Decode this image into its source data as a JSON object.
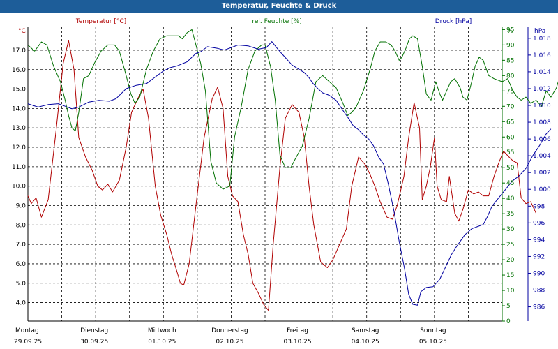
{
  "title": "Temperatur, Feuchte & Druck",
  "colors": {
    "temperature": "#b00000",
    "humidity": "#007000",
    "pressure": "#0000a0",
    "title_bg": "#1d5d99",
    "grid": "#000000"
  },
  "chart_data": {
    "type": "line",
    "title": "Temperatur, Feuchte & Druck",
    "grid": true,
    "x_axis": {
      "range": [
        0,
        7
      ],
      "days": [
        "Montag",
        "Dienstag",
        "Mittwoch",
        "Donnerstag",
        "Freitag",
        "Samstag",
        "Sonntag"
      ],
      "dates": [
        "29.09.25",
        "30.09.25",
        "01.10.25",
        "02.10.25",
        "03.10.25",
        "04.10.25",
        "05.10.25"
      ]
    },
    "axes": {
      "temperature": {
        "label": "Temperatur [°C]",
        "unit": "°C",
        "side": "left",
        "range": [
          3.05,
          18.22
        ],
        "ticks": [
          "4.0",
          "5.0",
          "6.0",
          "7.0",
          "8.0",
          "9.0",
          "10.0",
          "11.0",
          "12.0",
          "13.0",
          "14.0",
          "15.0",
          "16.0",
          "17.0"
        ]
      },
      "humidity": {
        "label": "rel. Feuchte [%]",
        "unit": "%",
        "side": "right",
        "range": [
          0,
          96
        ],
        "ticks": [
          "0",
          "5",
          "10",
          "15",
          "20",
          "25",
          "30",
          "35",
          "40",
          "45",
          "50",
          "55",
          "60",
          "65",
          "70",
          "75",
          "80",
          "85",
          "90",
          "95"
        ]
      },
      "pressure": {
        "label": "Druck [hPa]",
        "unit": "hPa",
        "side": "right",
        "range": [
          984.3,
          1019.4
        ],
        "ticks": [
          "986",
          "988",
          "990",
          "992",
          "994",
          "996",
          "998",
          "1.000",
          "1.002",
          "1.004",
          "1.006",
          "1.008",
          "1.010",
          "1.012",
          "1.014",
          "1.016",
          "1.018"
        ]
      }
    },
    "series": [
      {
        "name": "Temperatur [°C]",
        "axis": "temperature",
        "points": [
          [
            0,
            9.5
          ],
          [
            0.05,
            9.1
          ],
          [
            0.12,
            9.4
          ],
          [
            0.2,
            8.4
          ],
          [
            0.3,
            9.3
          ],
          [
            0.42,
            13.0
          ],
          [
            0.52,
            16.3
          ],
          [
            0.6,
            17.5
          ],
          [
            0.68,
            16.0
          ],
          [
            0.75,
            12.5
          ],
          [
            0.85,
            11.5
          ],
          [
            0.95,
            10.8
          ],
          [
            1.03,
            10.0
          ],
          [
            1.1,
            9.8
          ],
          [
            1.18,
            10.1
          ],
          [
            1.25,
            9.7
          ],
          [
            1.35,
            10.3
          ],
          [
            1.45,
            12.0
          ],
          [
            1.53,
            13.8
          ],
          [
            1.62,
            14.5
          ],
          [
            1.7,
            15.0
          ],
          [
            1.78,
            13.5
          ],
          [
            1.88,
            10.0
          ],
          [
            1.96,
            8.5
          ],
          [
            2.05,
            7.5
          ],
          [
            2.12,
            6.5
          ],
          [
            2.2,
            5.6
          ],
          [
            2.25,
            5.0
          ],
          [
            2.3,
            4.9
          ],
          [
            2.38,
            6.0
          ],
          [
            2.48,
            9.0
          ],
          [
            2.6,
            12.5
          ],
          [
            2.72,
            14.5
          ],
          [
            2.8,
            15.1
          ],
          [
            2.88,
            14.0
          ],
          [
            2.95,
            10.5
          ],
          [
            3.02,
            9.5
          ],
          [
            3.1,
            9.2
          ],
          [
            3.18,
            7.5
          ],
          [
            3.25,
            6.5
          ],
          [
            3.32,
            5.0
          ],
          [
            3.4,
            4.5
          ],
          [
            3.48,
            3.9
          ],
          [
            3.55,
            3.6
          ],
          [
            3.62,
            7.0
          ],
          [
            3.72,
            11.0
          ],
          [
            3.8,
            13.5
          ],
          [
            3.9,
            14.2
          ],
          [
            4.0,
            13.8
          ],
          [
            4.08,
            12.5
          ],
          [
            4.15,
            10.0
          ],
          [
            4.22,
            8.0
          ],
          [
            4.32,
            6.1
          ],
          [
            4.42,
            5.8
          ],
          [
            4.5,
            6.2
          ],
          [
            4.6,
            7.0
          ],
          [
            4.7,
            7.8
          ],
          [
            4.78,
            10.0
          ],
          [
            4.88,
            11.5
          ],
          [
            4.98,
            11.1
          ],
          [
            5.05,
            10.6
          ],
          [
            5.12,
            10.0
          ],
          [
            5.2,
            9.2
          ],
          [
            5.3,
            8.4
          ],
          [
            5.38,
            8.3
          ],
          [
            5.45,
            9.0
          ],
          [
            5.55,
            10.5
          ],
          [
            5.62,
            12.5
          ],
          [
            5.7,
            14.3
          ],
          [
            5.78,
            13.0
          ],
          [
            5.82,
            9.3
          ],
          [
            5.88,
            10.0
          ],
          [
            5.94,
            11.0
          ],
          [
            6.0,
            12.5
          ],
          [
            6.04,
            10.0
          ],
          [
            6.1,
            9.3
          ],
          [
            6.18,
            9.2
          ],
          [
            6.22,
            10.5
          ],
          [
            6.3,
            8.6
          ],
          [
            6.36,
            8.2
          ],
          [
            6.42,
            8.8
          ],
          [
            6.5,
            9.8
          ],
          [
            6.58,
            9.6
          ],
          [
            6.65,
            9.7
          ],
          [
            6.72,
            9.5
          ],
          [
            6.8,
            9.5
          ],
          [
            6.88,
            10.5
          ],
          [
            6.95,
            11.2
          ],
          [
            7.02,
            11.8
          ],
          [
            7.1,
            11.5
          ],
          [
            7.16,
            11.3
          ],
          [
            7.22,
            11.2
          ],
          [
            7.28,
            9.4
          ],
          [
            7.35,
            9.1
          ],
          [
            7.42,
            9.2
          ],
          [
            7.5,
            8.6
          ]
        ]
      },
      {
        "name": "rel. Feuchte [%]",
        "axis": "humidity",
        "points": [
          [
            0,
            90
          ],
          [
            0.1,
            88
          ],
          [
            0.2,
            91
          ],
          [
            0.28,
            90
          ],
          [
            0.38,
            83
          ],
          [
            0.48,
            78
          ],
          [
            0.55,
            72
          ],
          [
            0.6,
            67
          ],
          [
            0.65,
            63
          ],
          [
            0.7,
            62
          ],
          [
            0.75,
            68
          ],
          [
            0.82,
            79
          ],
          [
            0.9,
            80
          ],
          [
            0.98,
            84
          ],
          [
            1.08,
            88
          ],
          [
            1.18,
            90
          ],
          [
            1.28,
            90
          ],
          [
            1.35,
            88
          ],
          [
            1.45,
            80
          ],
          [
            1.52,
            74
          ],
          [
            1.58,
            71
          ],
          [
            1.65,
            73
          ],
          [
            1.75,
            82
          ],
          [
            1.85,
            88
          ],
          [
            1.95,
            92
          ],
          [
            2.05,
            93
          ],
          [
            2.15,
            93
          ],
          [
            2.22,
            93
          ],
          [
            2.28,
            92
          ],
          [
            2.35,
            94
          ],
          [
            2.42,
            95
          ],
          [
            2.48,
            90
          ],
          [
            2.55,
            84
          ],
          [
            2.62,
            75
          ],
          [
            2.7,
            52
          ],
          [
            2.78,
            45
          ],
          [
            2.88,
            43
          ],
          [
            2.98,
            44
          ],
          [
            3.05,
            60
          ],
          [
            3.15,
            70
          ],
          [
            3.25,
            82
          ],
          [
            3.35,
            88
          ],
          [
            3.45,
            90
          ],
          [
            3.5,
            90
          ],
          [
            3.58,
            83
          ],
          [
            3.65,
            72
          ],
          [
            3.72,
            54
          ],
          [
            3.8,
            50
          ],
          [
            3.88,
            50
          ],
          [
            3.95,
            53
          ],
          [
            4.05,
            57
          ],
          [
            4.15,
            66
          ],
          [
            4.25,
            78
          ],
          [
            4.35,
            80
          ],
          [
            4.45,
            78
          ],
          [
            4.55,
            76
          ],
          [
            4.65,
            71
          ],
          [
            4.72,
            67
          ],
          [
            4.78,
            68
          ],
          [
            4.85,
            70
          ],
          [
            4.95,
            75
          ],
          [
            5.05,
            82
          ],
          [
            5.12,
            88
          ],
          [
            5.2,
            91
          ],
          [
            5.28,
            91
          ],
          [
            5.36,
            90
          ],
          [
            5.42,
            88
          ],
          [
            5.48,
            85
          ],
          [
            5.52,
            86
          ],
          [
            5.58,
            89
          ],
          [
            5.63,
            92
          ],
          [
            5.68,
            93
          ],
          [
            5.75,
            92
          ],
          [
            5.82,
            83
          ],
          [
            5.88,
            74
          ],
          [
            5.95,
            72
          ],
          [
            6.02,
            78
          ],
          [
            6.08,
            74
          ],
          [
            6.12,
            72
          ],
          [
            6.18,
            75
          ],
          [
            6.24,
            78
          ],
          [
            6.3,
            79
          ],
          [
            6.38,
            76
          ],
          [
            6.42,
            73
          ],
          [
            6.48,
            72
          ],
          [
            6.55,
            78
          ],
          [
            6.6,
            83
          ],
          [
            6.66,
            86
          ],
          [
            6.72,
            85
          ],
          [
            6.8,
            80
          ],
          [
            6.88,
            79
          ],
          [
            7.0,
            78
          ],
          [
            7.08,
            79
          ],
          [
            7.16,
            75
          ],
          [
            7.22,
            73
          ],
          [
            7.28,
            72
          ],
          [
            7.35,
            73
          ],
          [
            7.42,
            71
          ],
          [
            7.5,
            72
          ],
          [
            7.58,
            70
          ],
          [
            7.65,
            75
          ],
          [
            7.72,
            73
          ],
          [
            7.8,
            76
          ],
          [
            7.88,
            82
          ],
          [
            7.95,
            80
          ]
        ]
      },
      {
        "name": "Druck [hPa]",
        "axis": "pressure",
        "points": [
          [
            0,
            1010.2
          ],
          [
            0.15,
            1009.8
          ],
          [
            0.3,
            1010.1
          ],
          [
            0.45,
            1010.2
          ],
          [
            0.55,
            1009.9
          ],
          [
            0.65,
            1009.6
          ],
          [
            0.75,
            1009.8
          ],
          [
            0.9,
            1010.4
          ],
          [
            1.05,
            1010.6
          ],
          [
            1.2,
            1010.5
          ],
          [
            1.3,
            1010.8
          ],
          [
            1.45,
            1012.0
          ],
          [
            1.6,
            1012.4
          ],
          [
            1.75,
            1012.6
          ],
          [
            1.85,
            1013.2
          ],
          [
            2.0,
            1014.1
          ],
          [
            2.1,
            1014.5
          ],
          [
            2.2,
            1014.7
          ],
          [
            2.35,
            1015.2
          ],
          [
            2.48,
            1016.2
          ],
          [
            2.55,
            1016.4
          ],
          [
            2.65,
            1017.0
          ],
          [
            2.8,
            1016.8
          ],
          [
            2.9,
            1016.6
          ],
          [
            3.0,
            1016.9
          ],
          [
            3.1,
            1017.2
          ],
          [
            3.25,
            1017.1
          ],
          [
            3.4,
            1016.7
          ],
          [
            3.52,
            1016.9
          ],
          [
            3.6,
            1017.6
          ],
          [
            3.7,
            1016.6
          ],
          [
            3.8,
            1015.7
          ],
          [
            3.9,
            1014.8
          ],
          [
            4.0,
            1014.3
          ],
          [
            4.08,
            1013.9
          ],
          [
            4.15,
            1013.3
          ],
          [
            4.2,
            1012.7
          ],
          [
            4.28,
            1012.0
          ],
          [
            4.35,
            1011.5
          ],
          [
            4.45,
            1011.2
          ],
          [
            4.55,
            1010.6
          ],
          [
            4.65,
            1009.4
          ],
          [
            4.72,
            1008.6
          ],
          [
            4.8,
            1007.6
          ],
          [
            4.88,
            1007.1
          ],
          [
            4.95,
            1006.5
          ],
          [
            5.03,
            1006.0
          ],
          [
            5.1,
            1005.2
          ],
          [
            5.18,
            1003.8
          ],
          [
            5.25,
            1003.0
          ],
          [
            5.32,
            1000.6
          ],
          [
            5.4,
            997.5
          ],
          [
            5.48,
            993.8
          ],
          [
            5.56,
            990.5
          ],
          [
            5.62,
            987.5
          ],
          [
            5.68,
            986.3
          ],
          [
            5.75,
            986.2
          ],
          [
            5.8,
            987.8
          ],
          [
            5.88,
            988.3
          ],
          [
            5.98,
            988.4
          ],
          [
            6.08,
            989.3
          ],
          [
            6.15,
            990.5
          ],
          [
            6.25,
            992.2
          ],
          [
            6.32,
            993.1
          ],
          [
            6.38,
            993.8
          ],
          [
            6.45,
            994.6
          ],
          [
            6.55,
            995.3
          ],
          [
            6.65,
            995.6
          ],
          [
            6.72,
            995.8
          ],
          [
            6.78,
            996.7
          ],
          [
            6.85,
            998.0
          ],
          [
            6.95,
            999.0
          ],
          [
            7.05,
            1000.0
          ],
          [
            7.15,
            1001.0
          ],
          [
            7.25,
            1001.6
          ],
          [
            7.35,
            1002.5
          ],
          [
            7.45,
            1004.0
          ],
          [
            7.55,
            1005.2
          ],
          [
            7.65,
            1006.6
          ],
          [
            7.72,
            1007.2
          ]
        ]
      }
    ]
  }
}
